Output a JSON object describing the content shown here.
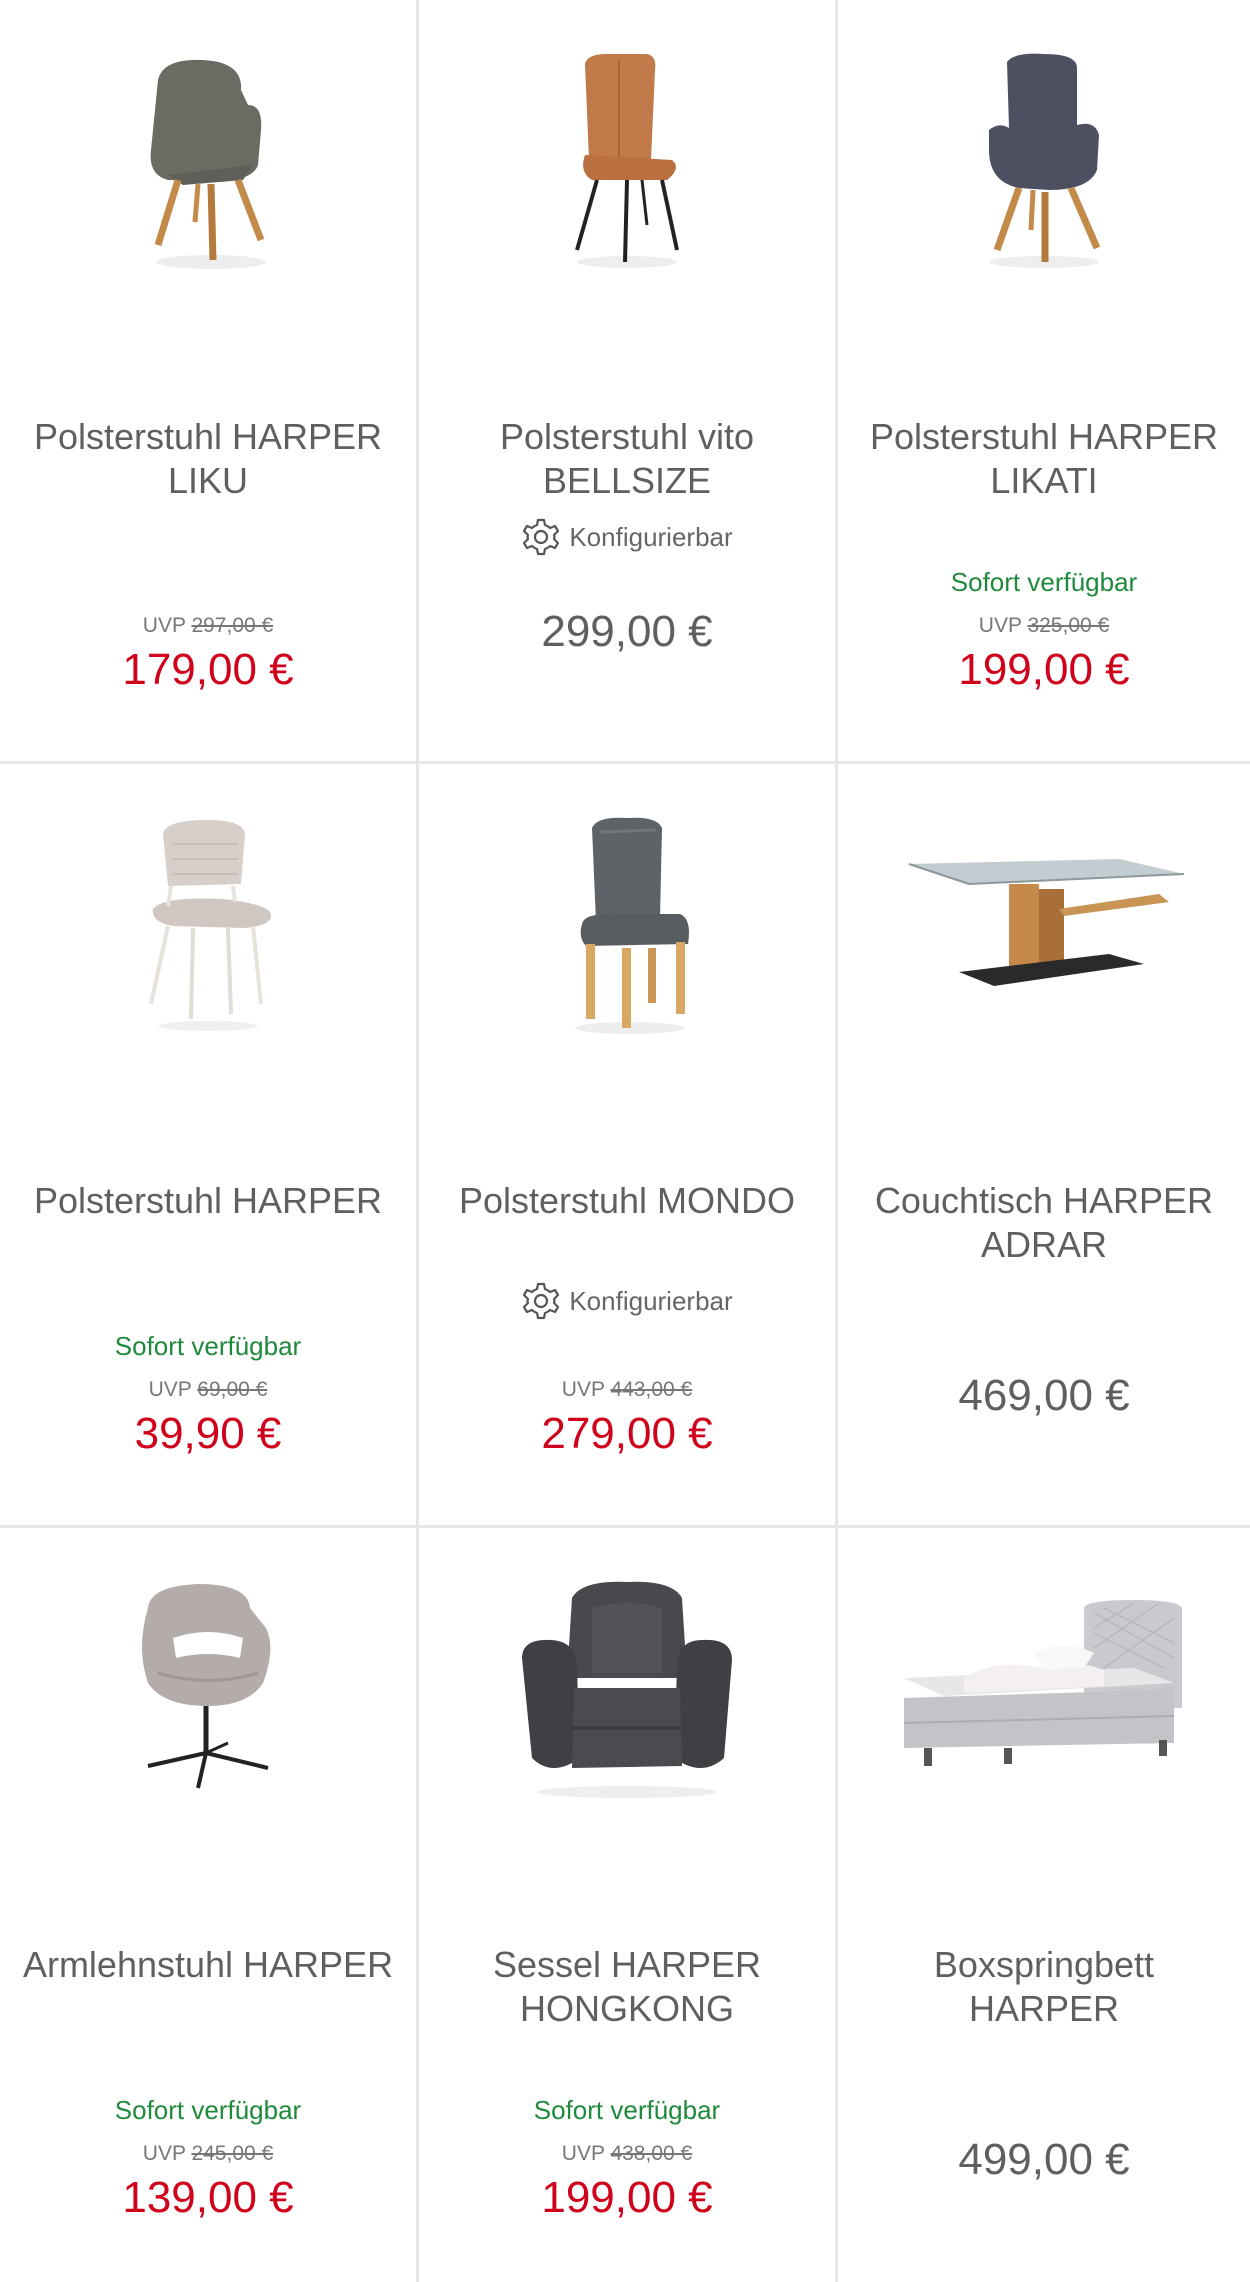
{
  "products": [
    {
      "title": "Polsterstuhl HARPER LIKU",
      "uvp_label": "UVP",
      "uvp": "297,00 €",
      "price": "179,00 €"
    },
    {
      "title": "Polsterstuhl vito BELLSIZE",
      "config": "Konfigurierbar",
      "price": "299,00 €"
    },
    {
      "title": "Polsterstuhl HARPER LIKATI",
      "availability": "Sofort verfügbar",
      "uvp_label": "UVP",
      "uvp": "325,00 €",
      "price": "199,00 €"
    },
    {
      "title": "Polsterstuhl HARPER",
      "availability": "Sofort verfügbar",
      "uvp_label": "UVP",
      "uvp": "69,00 €",
      "price": "39,90 €"
    },
    {
      "title": "Polsterstuhl MONDO",
      "config": "Konfigurierbar",
      "uvp_label": "UVP",
      "uvp": "443,00 €",
      "price": "279,00 €"
    },
    {
      "title": "Couchtisch HARPER ADRAR",
      "price": "469,00 €"
    },
    {
      "title": "Armlehnstuhl HARPER",
      "availability": "Sofort verfügbar",
      "uvp_label": "UVP",
      "uvp": "245,00 €",
      "price": "139,00 €"
    },
    {
      "title": "Sessel HARPER HONGKONG",
      "availability": "Sofort verfügbar",
      "uvp_label": "UVP",
      "uvp": "438,00 €",
      "price": "199,00 €"
    },
    {
      "title": "Boxspringbett HARPER",
      "price": "499,00 €"
    }
  ],
  "colors": {
    "sale": "#d0021b",
    "available": "#1f8a3c",
    "text": "#5f5f5f",
    "border": "#e6e6e6"
  }
}
